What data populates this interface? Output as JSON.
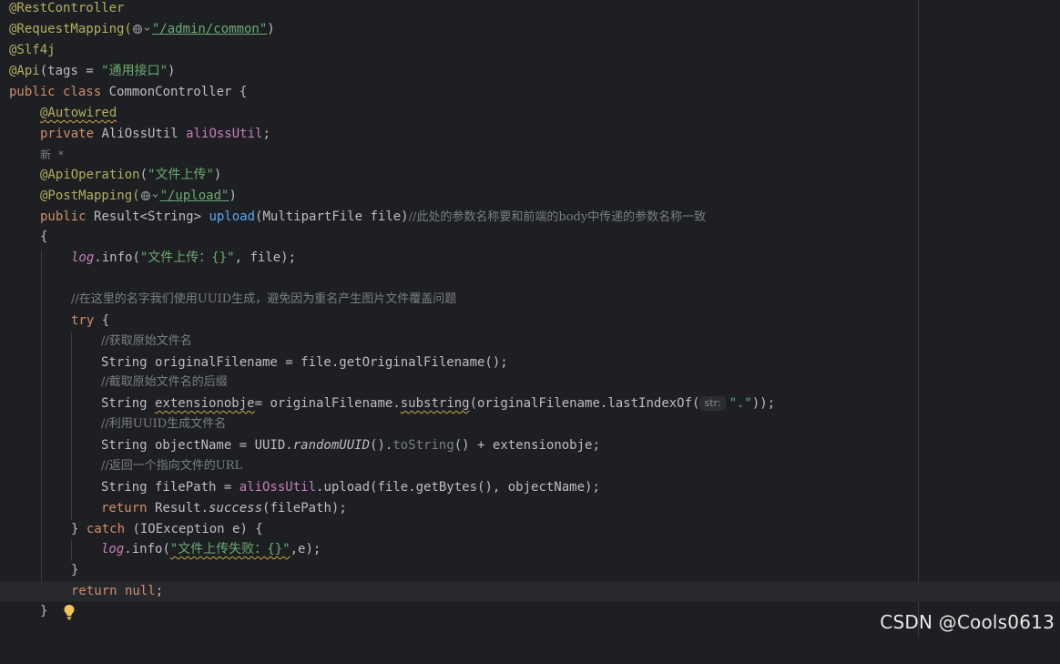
{
  "editor": {
    "lines": {
      "l1": "@RestController",
      "l2_ann": "@RequestMapping(",
      "l2_str": "\"/admin/common\"",
      "l2_end": ")",
      "l3": "@Slf4j",
      "l4_ann": "@Api",
      "l4_mid": "(tags = ",
      "l4_str": "\"通用接口\"",
      "l4_end": ")",
      "l5_kw": "public class ",
      "l5_rest": "CommonController {",
      "l6": "@Autowired",
      "l7_kw": "private ",
      "l7_type": "AliOssUtil ",
      "l7_fld": "aliOssUtil",
      "l7_end": ";",
      "l8": "新 *",
      "l9_ann": "@ApiOperation",
      "l9_p1": "(",
      "l9_str": "\"文件上传\"",
      "l9_p2": ")",
      "l10_ann": "@PostMapping(",
      "l10_str": "\"/upload\"",
      "l10_end": ")",
      "l11_kw": "public ",
      "l11_type": "Result<String> ",
      "l11_fn": "upload",
      "l11_params": "(MultipartFile file)",
      "l11_cmt": "//此处的参数名称要和前端的body中传递的参数名称一致",
      "l12": "{",
      "l13_log": "log",
      "l13_call": ".info(",
      "l13_str": "\"文件上传：{}\"",
      "l13_end": ", file);",
      "l15_cmt": "//在这里的名字我们使用UUID生成，避免因为重名产生图片文件覆盖问题",
      "l16_kw": "try",
      "l16_end": " {",
      "l17_cmt": "//获取原始文件名",
      "l18": "String originalFilename = file.getOriginalFilename();",
      "l19_cmt": "//截取原始文件名的后缀",
      "l20_a": "String ",
      "l20_var": "extensionobje",
      "l20_b": "= originalFilename.",
      "l20_sub": "substring",
      "l20_c": "(originalFilename.lastIndexOf(",
      "l20_hint": "str:",
      "l20_str": "\".\"",
      "l20_end": "));",
      "l21_cmt": "//利用UUID生成文件名",
      "l22_a": "String objectName = UUID.",
      "l22_fn": "randomUUID",
      "l22_b": "().",
      "l22_to": "toString",
      "l22_c": "() + extensionobje;",
      "l23_cmt": "//返回一个指向文件的URL",
      "l24_a": "String filePath = ",
      "l24_fld": "aliOssUtil",
      "l24_b": ".upload(file.getBytes(), objectName);",
      "l25_kw": "return ",
      "l25_a": "Result.",
      "l25_fn": "success",
      "l25_b": "(filePath);",
      "l26_a": "} ",
      "l26_kw": "catch",
      "l26_b": " (IOException e) {",
      "l27_log": "log",
      "l27_call": ".info(",
      "l27_str": "\"文件上传失败：{}\"",
      "l27_end": ",e);",
      "l28": "}",
      "l29_kw": "return null",
      "l29_end": ";",
      "l30": "}"
    }
  },
  "watermark": "CSDN @Cools0613",
  "icons": [
    "web-endpoint-icon",
    "lightbulb-icon"
  ],
  "colors": {
    "background": "#1e1f22",
    "keyword": "#cf8e6d",
    "annotation": "#b3ae60",
    "string": "#6aab73",
    "comment": "#7a7e85",
    "field": "#c77dbb",
    "method": "#56a8f5"
  }
}
